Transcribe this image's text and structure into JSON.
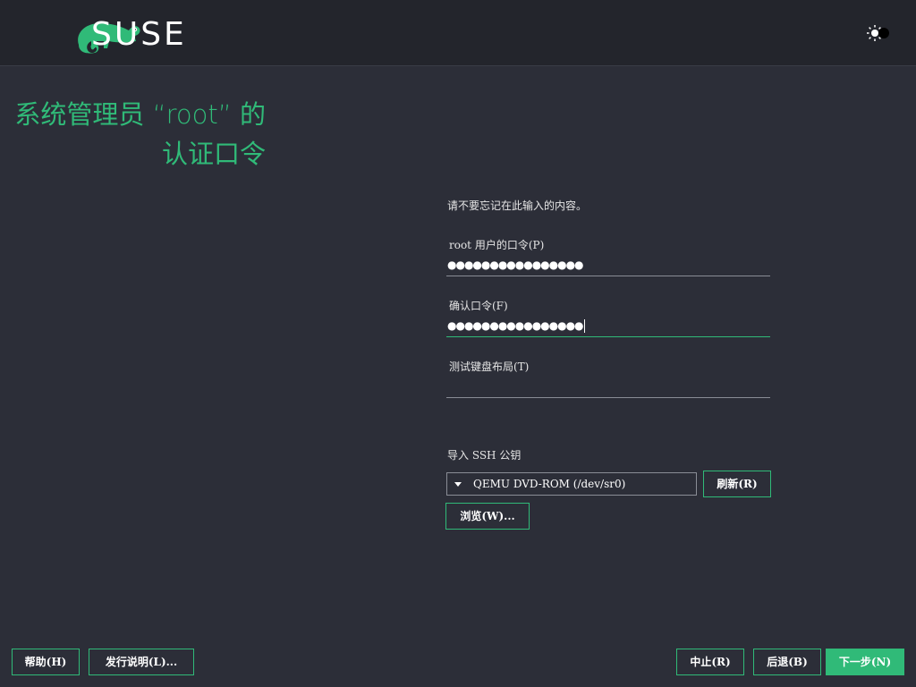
{
  "header": {
    "brand": "SUSE",
    "logo_icon": "suse-chameleon-icon",
    "theme_icon": "theme-toggle-icon"
  },
  "title": {
    "line1": "系统管理员 “root” 的",
    "line2": "认证口令"
  },
  "notice": "请不要忘记在此输入的内容。",
  "fields": {
    "password": {
      "label": "root 用户的口令(P)",
      "value": "●●●●●●●●●●●●●●●●"
    },
    "confirm": {
      "label": "确认口令(F)",
      "value": "●●●●●●●●●●●●●●●●"
    },
    "keyboard_test": {
      "label": "测试键盘布局(T)",
      "value": ""
    }
  },
  "ssh": {
    "label": "导入 SSH 公钥",
    "selected_device": "QEMU DVD-ROM (/dev/sr0)",
    "refresh_label": "刷新(R)",
    "browse_label": "浏览(W)..."
  },
  "footer": {
    "help_label": "帮助(H)",
    "release_notes_label": "发行说明(L)...",
    "abort_label": "中止(R)",
    "back_label": "后退(B)",
    "next_label": "下一步(N)"
  },
  "colors": {
    "accent": "#30ba78",
    "background": "#2c2e38",
    "header_bg": "#23252c"
  }
}
